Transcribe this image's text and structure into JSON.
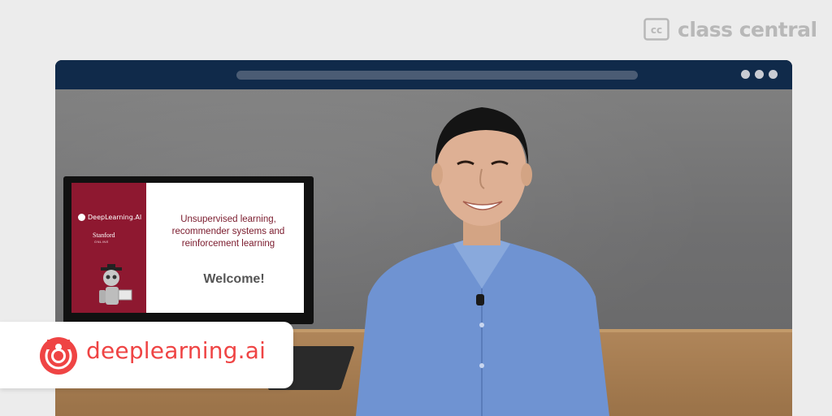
{
  "brand": {
    "text": "class central",
    "icon": "cc-logo-icon",
    "color": "#b8b8b8"
  },
  "browser": {
    "titlebar_color": "#102a4a",
    "menu_icon": "ellipsis-icon"
  },
  "video": {
    "slide": {
      "logo_text": "DeepLearning.AI",
      "partner": "Stanford",
      "partner_sub": "ONLINE",
      "title": "Unsupervised learning, recommender systems and reinforcement learning",
      "welcome": "Welcome!"
    }
  },
  "provider": {
    "name": "deeplearning.ai",
    "icon": "deeplearning-ai-logo-icon",
    "color": "#ef4444"
  }
}
